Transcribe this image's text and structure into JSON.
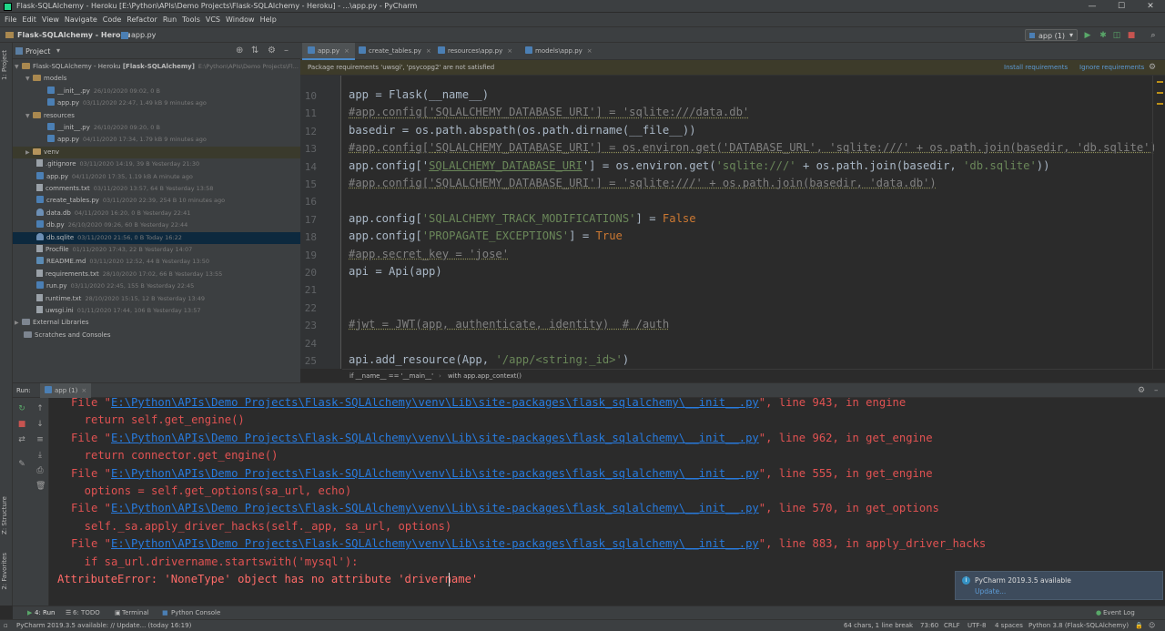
{
  "window": {
    "title": "Flask-SQLAlchemy - Heroku [E:\\Python\\APIs\\Demo Projects\\Flask-SQLAlchemy - Heroku] - ...\\app.py - PyCharm",
    "controls": [
      "—",
      "☐",
      "✕"
    ]
  },
  "menu": [
    "File",
    "Edit",
    "View",
    "Navigate",
    "Code",
    "Refactor",
    "Run",
    "Tools",
    "VCS",
    "Window",
    "Help"
  ],
  "nav": {
    "project": "Flask-SQLAlchemy - Heroku",
    "file": "app.py",
    "run_config": "app (1)"
  },
  "project_panel": {
    "title": "Project",
    "rows": [
      {
        "name": "Flask-SQLAlchemy - Heroku",
        "bold": "[Flask-SQLAlchemy]",
        "meta": "E:\\Python\\APIs\\Demo Projects\\Fl..."
      },
      {
        "name": "models",
        "meta": ""
      },
      {
        "name": "__init__.py",
        "meta": "26/10/2020 09:02, 0 B"
      },
      {
        "name": "app.py",
        "meta": "03/11/2020 22:47, 1.49 kB 9 minutes ago"
      },
      {
        "name": "resources",
        "meta": ""
      },
      {
        "name": "__init__.py",
        "meta": "26/10/2020 09:20, 0 B"
      },
      {
        "name": "app.py",
        "meta": "04/11/2020 17:34, 1.79 kB 9 minutes ago"
      },
      {
        "name": "venv",
        "meta": ""
      },
      {
        "name": ".gitignore",
        "meta": "03/11/2020 14:19, 39 B Yesterday 21:30"
      },
      {
        "name": "app.py",
        "meta": "04/11/2020 17:35, 1.19 kB A minute ago"
      },
      {
        "name": "comments.txt",
        "meta": "03/11/2020 13:57, 64 B Yesterday 13:58"
      },
      {
        "name": "create_tables.py",
        "meta": "03/11/2020 22:39, 254 B 10 minutes ago"
      },
      {
        "name": "data.db",
        "meta": "04/11/2020 16:20, 0 B Yesterday 22:41"
      },
      {
        "name": "db.py",
        "meta": "26/10/2020 09:26, 60 B Yesterday 22:44"
      },
      {
        "name": "db.sqlite",
        "meta": "03/11/2020 21:56, 0 B Today 16:22"
      },
      {
        "name": "Procfile",
        "meta": "01/11/2020 17:43, 22 B Yesterday 14:07"
      },
      {
        "name": "README.md",
        "meta": "03/11/2020 12:52, 44 B Yesterday 13:50"
      },
      {
        "name": "requirements.txt",
        "meta": "28/10/2020 17:02, 66 B Yesterday 13:55"
      },
      {
        "name": "run.py",
        "meta": "03/11/2020 22:45, 155 B Yesterday 22:45"
      },
      {
        "name": "runtime.txt",
        "meta": "28/10/2020 15:15, 12 B Yesterday 13:49"
      },
      {
        "name": "uwsgi.ini",
        "meta": "01/11/2020 17:44, 106 B Yesterday 13:57"
      },
      {
        "name": "External Libraries",
        "meta": ""
      },
      {
        "name": "Scratches and Consoles",
        "meta": ""
      }
    ]
  },
  "tabs": [
    {
      "label": "app.py",
      "active": true
    },
    {
      "label": "create_tables.py",
      "active": false
    },
    {
      "label": "resources\\app.py",
      "active": false
    },
    {
      "label": "models\\app.py",
      "active": false
    }
  ],
  "banner": {
    "message": "Package requirements 'uwsgi', 'psycopg2' are not satisfied",
    "install": "Install requirements",
    "ignore": "Ignore requirements"
  },
  "line_numbers": [
    "10",
    "11",
    "12",
    "13",
    "14",
    "15",
    "16",
    "17",
    "18",
    "19",
    "20",
    "21",
    "22",
    "23",
    "24",
    "25"
  ],
  "code": {
    "l10": "app = Flask(__name__)",
    "l11a": "#app.config['",
    "l11b": "SQLALCHEMY_DATABASE_URI",
    "l11c": "'] = 'sqlite:///data.db'",
    "l12": "basedir = os.path.abspath(os.path.dirname(__file__))",
    "l13a": "#app.config['",
    "l13b": "SQLALCHEMY_DATABASE_URI",
    "l13c": "'] = os.environ.get('DATABASE_URL', 'sqlite:///' + os.path.join(basedir, 'db.sqlite'))",
    "l14a": "app.config['",
    "l14b": "SQLALCHEMY_DATABASE_URI",
    "l14c": "'] = os.environ.get(",
    "l14d": "'sqlite:///'",
    "l14e": " + os.path.join(basedir, ",
    "l14f": "'db.sqlite'",
    "l14g": "))",
    "l15a": "#app.config['",
    "l15b": "SQLALCHEMY_DATABASE_URI",
    "l15c": "'] = 'sqlite:///' + os.path.join(basedir, 'data.db')",
    "l17a": "app.config[",
    "l17b": "'SQLALCHEMY_TRACK_MODIFICATIONS'",
    "l17c": "] = ",
    "l17d": "False",
    "l18a": "app.config[",
    "l18b": "'PROPAGATE_EXCEPTIONS'",
    "l18c": "] = ",
    "l18d": "True",
    "l19": "#app.secret_key = 'jose'",
    "l20": "api = Api(app)",
    "l23": "#jwt = JWT(app, authenticate, identity)  # /auth",
    "l25a": "api.add_resource(App, ",
    "l25b": "'/app/<string:_id>'",
    "l25c": ")"
  },
  "breadcrumb": {
    "c1": "if __name__ == '__main__'",
    "c2": "with app.app_context()"
  },
  "run_panel": {
    "label": "Run:",
    "tab": "app (1)"
  },
  "console": {
    "line1_pre": "File \"",
    "line1_path": "E:\\Python\\APIs\\Demo Projects\\Flask-SQLAlchemy\\venv\\Lib\\site-packages\\flask_sqlalchemy\\__init__.py",
    "line1_post": "\", line 943, in engine",
    "line2": "  return self.get_engine()",
    "line3_pre": "File \"",
    "line3_path": "E:\\Python\\APIs\\Demo Projects\\Flask-SQLAlchemy\\venv\\Lib\\site-packages\\flask_sqlalchemy\\__init__.py",
    "line3_post": "\", line 962, in get_engine",
    "line4": "  return connector.get_engine()",
    "line5_pre": "File \"",
    "line5_path": "E:\\Python\\APIs\\Demo Projects\\Flask-SQLAlchemy\\venv\\Lib\\site-packages\\flask_sqlalchemy\\__init__.py",
    "line5_post": "\", line 555, in get_engine",
    "line6": "  options = self.get_options(sa_url, echo)",
    "line7_pre": "File \"",
    "line7_path": "E:\\Python\\APIs\\Demo Projects\\Flask-SQLAlchemy\\venv\\Lib\\site-packages\\flask_sqlalchemy\\__init__.py",
    "line7_post": "\", line 570, in get_options",
    "line8": "  self._sa.apply_driver_hacks(self._app, sa_url, options)",
    "line9_pre": "File \"",
    "line9_path": "E:\\Python\\APIs\\Demo Projects\\Flask-SQLAlchemy\\venv\\Lib\\site-packages\\flask_sqlalchemy\\__init__.py",
    "line9_post": "\", line 883, in apply_driver_hacks",
    "line10": "  if sa_url.drivername.startswith('mysql'):",
    "error": "AttributeError: 'NoneType' object has no attribute 'drivername'"
  },
  "notification": {
    "title": "PyCharm 2019.3.5 available",
    "link": "Update..."
  },
  "side_tabs": {
    "project": "1: Project",
    "structure": "Z: Structure",
    "favorites": "2: Favorites"
  },
  "bottom_tabs": {
    "run": "4: Run",
    "todo": "6: TODO",
    "terminal": "Terminal",
    "console": "Python Console",
    "eventlog": "Event Log"
  },
  "status": {
    "message": "PyCharm 2019.3.5 available: // Update... (today 16:19)",
    "chars": "64 chars, 1 line break",
    "pos": "73:60",
    "crlf": "CRLF",
    "enc": "UTF-8",
    "indent": "4 spaces",
    "interp": "Python 3.8 (Flask-SQLAlchemy)"
  },
  "colors": {
    "accent": "#4a88c7",
    "error": "#e05252",
    "link": "#287bde",
    "selection": "#214283"
  }
}
